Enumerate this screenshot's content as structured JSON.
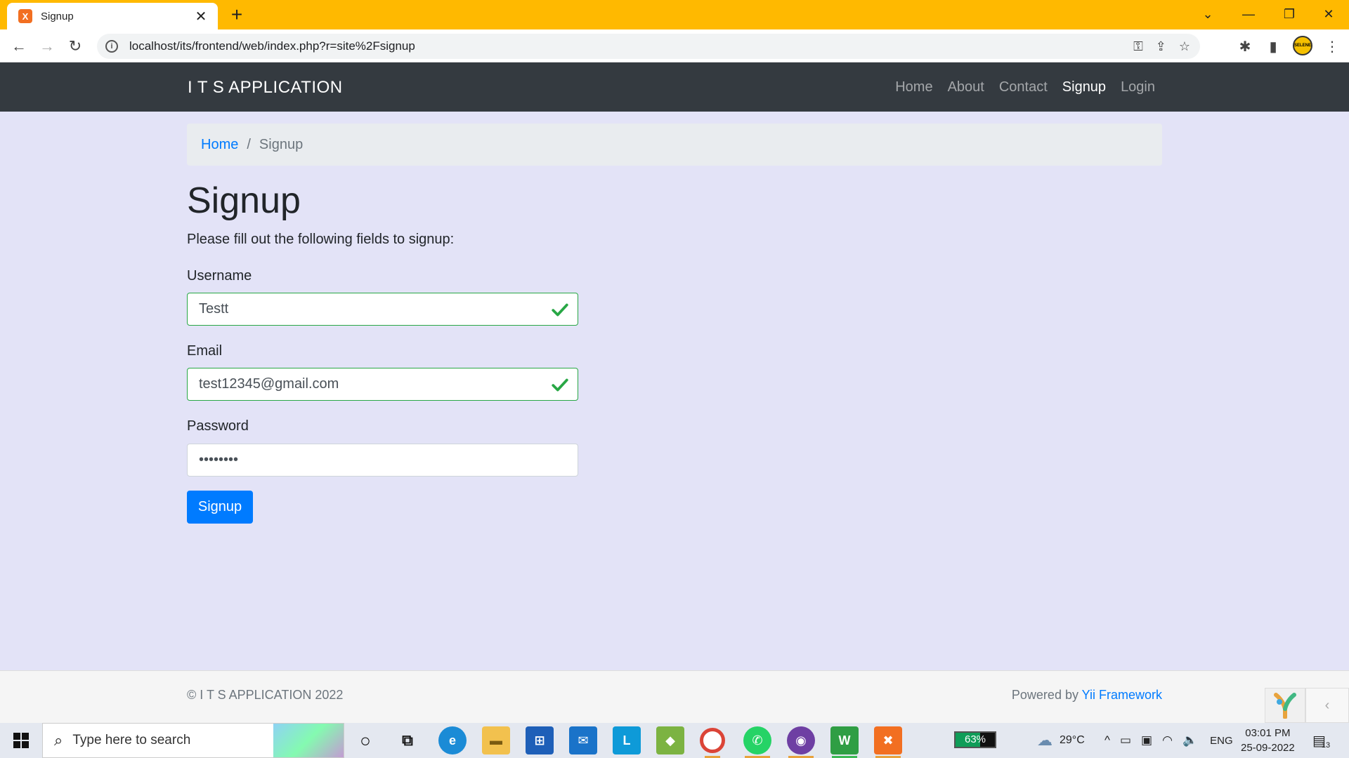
{
  "browser": {
    "tab_title": "Signup",
    "favicon": "X",
    "new_tab": "+",
    "url": "localhost/its/frontend/web/index.php?r=site%2Fsignup",
    "profile_label": "SELENE"
  },
  "site": {
    "brand": "I T S APPLICATION",
    "nav": [
      {
        "label": "Home"
      },
      {
        "label": "About"
      },
      {
        "label": "Contact"
      },
      {
        "label": "Signup",
        "active": true
      },
      {
        "label": "Login"
      }
    ]
  },
  "breadcrumb": {
    "home": "Home",
    "separator": "/",
    "current": "Signup"
  },
  "page": {
    "title": "Signup",
    "intro": "Please fill out the following fields to signup:"
  },
  "form": {
    "username": {
      "label": "Username",
      "value": "Testt"
    },
    "email": {
      "label": "Email",
      "value": "test12345@gmail.com"
    },
    "password": {
      "label": "Password",
      "value": "••••••••"
    },
    "submit_label": "Signup"
  },
  "footer": {
    "copyright": "© I T S APPLICATION 2022",
    "powered_prefix": "Powered by ",
    "powered_link": "Yii Framework"
  },
  "taskbar": {
    "search_placeholder": "Type here to search",
    "battery": "63%",
    "battery_level": 0.63,
    "weather": "29°C",
    "language": "ENG",
    "time": "03:01 PM",
    "date": "25-09-2022",
    "notifications": "13"
  },
  "colors": {
    "tabbar": "#ffb900",
    "navbar": "#343a40",
    "page_bg": "#e3e3f7",
    "primary": "#007bff",
    "valid": "#28a745"
  }
}
